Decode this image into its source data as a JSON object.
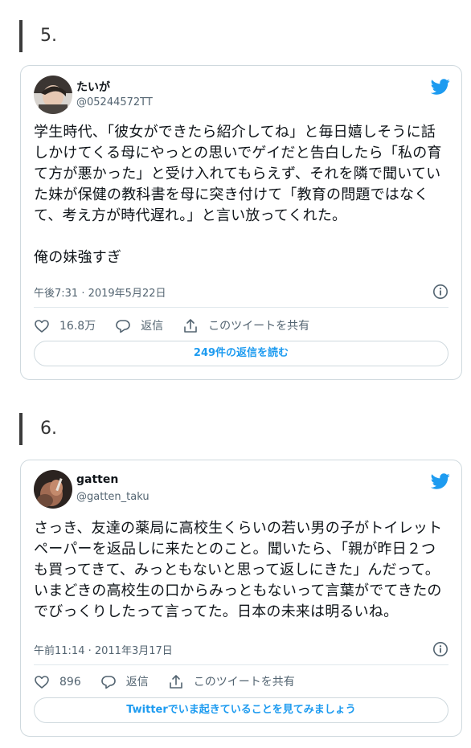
{
  "sections": [
    {
      "number": "5.",
      "tweet": {
        "author_name": "たいが",
        "author_handle": "@05244572TT",
        "avatar_icon": "profile-photo",
        "text": "学生時代、「彼女ができたら紹介してね」と毎日嬉しそうに話しかけてくる母にやっとの思いでゲイだと告白したら「私の育て方が悪かった」と受け入れてもらえず、それを隣で聞いていた妹が保健の教科書を母に突き付けて「教育の問題ではなくて、考え方が時代遅れ。」と言い放ってくれた。\n\n俺の妹強すぎ",
        "timestamp": "午後7:31 · 2019年5月22日",
        "likes": "16.8万",
        "reply_label": "返信",
        "share_label": "このツイートを共有",
        "cta_label": "249件の返信を読む"
      }
    },
    {
      "number": "6.",
      "tweet": {
        "author_name": "gatten",
        "author_handle": "@gatten_taku",
        "avatar_icon": "profile-photo",
        "text": "さっき、友達の薬局に高校生くらいの若い男の子がトイレットペーパーを返品しに来たとのこと。聞いたら、「親が昨日２つも買ってきて、みっともないと思って返しにきた」んだって。いまどきの高校生の口からみっともないって言葉がでてきたのでびっくりしたって言ってた。日本の未来は明るいね。",
        "timestamp": "午前11:14 · 2011年3月17日",
        "likes": "896",
        "reply_label": "返信",
        "share_label": "このツイートを共有",
        "cta_label": "Twitterでいま起きていることを見てみましょう"
      }
    }
  ],
  "colors": {
    "accent": "#1d9bf0",
    "text_primary": "#0f1419",
    "text_secondary": "#536471",
    "border": "#cfd9de"
  }
}
